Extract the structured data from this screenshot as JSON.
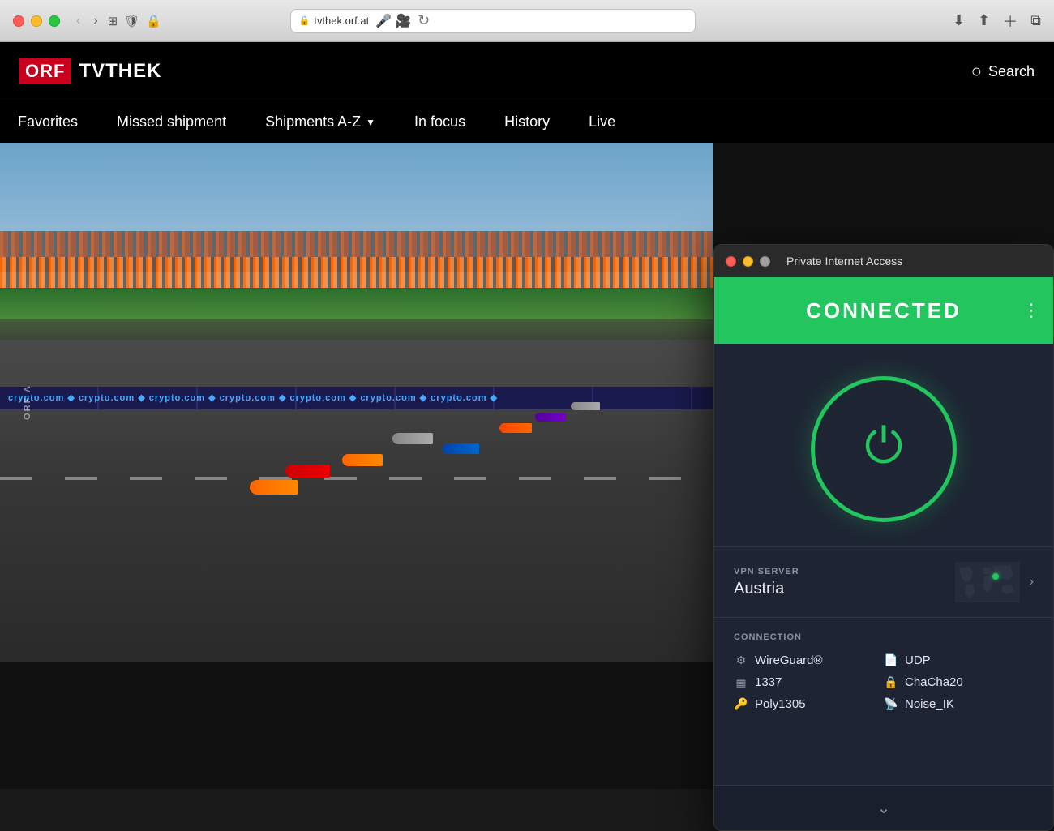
{
  "titlebar": {
    "url": "tvthek.orf.at",
    "lock_icon": "🔒"
  },
  "orf": {
    "logo_orf": "ORF",
    "logo_tvthek": "TVTHEK",
    "search_label": "Search",
    "nav_items": [
      {
        "label": "Favorites",
        "has_dropdown": false
      },
      {
        "label": "Missed shipment",
        "has_dropdown": false
      },
      {
        "label": "Shipments A-Z",
        "has_dropdown": true
      },
      {
        "label": "In focus",
        "has_dropdown": false
      },
      {
        "label": "History",
        "has_dropdown": false
      },
      {
        "label": "Live",
        "has_dropdown": false
      }
    ],
    "watermark": "ORF A"
  },
  "crypto_banner": "crypto.com  ◆ crypto.com  ◆ crypto.com  ◆ crypto.com  ◆ crypto.com  ◆ crypto.com  ◆ crypto.com  ◆",
  "pia": {
    "window_title": "Private Internet Access",
    "status": "CONNECTED",
    "vpn_server_label": "VPN SERVER",
    "vpn_server_name": "Austria",
    "connection_label": "CONNECTION",
    "connection_items": [
      {
        "icon": "🔧",
        "value": "WireGuard®"
      },
      {
        "icon": "📋",
        "value": "UDP"
      },
      {
        "icon": "🔢",
        "value": "1337"
      },
      {
        "icon": "🔒",
        "value": "ChaCha20"
      },
      {
        "icon": "🔑",
        "value": "Poly1305"
      },
      {
        "icon": "📡",
        "value": "Noise_IK"
      }
    ],
    "colors": {
      "connected_green": "#22c55e",
      "power_ring": "#22c55e"
    }
  }
}
